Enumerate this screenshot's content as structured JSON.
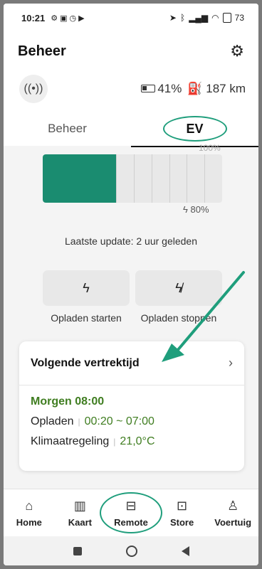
{
  "status_bar": {
    "time": "10:21",
    "battery": "73"
  },
  "app_bar": {
    "title": "Beheer"
  },
  "vehicle_info": {
    "battery_percent": "41%",
    "range": "187 km"
  },
  "tabs": [
    {
      "label": "Beheer"
    },
    {
      "label": "EV"
    }
  ],
  "battery": {
    "level_percent": 41,
    "max_label": "100%",
    "limit_label": "80%",
    "last_update": "Laatste update: 2 uur geleden"
  },
  "charge_actions": {
    "start_label": "Opladen starten",
    "stop_label": "Opladen stoppen"
  },
  "departure_card": {
    "title": "Volgende vertrektijd",
    "time": "Morgen 08:00",
    "charge_label": "Opladen",
    "charge_window": "00:20 ~ 07:00",
    "climate_label": "Klimaatregeling",
    "climate_temp": "21,0°C"
  },
  "bottom_nav": [
    {
      "label": "Home",
      "icon": "home-icon"
    },
    {
      "label": "Kaart",
      "icon": "map-icon"
    },
    {
      "label": "Remote",
      "icon": "car-icon"
    },
    {
      "label": "Store",
      "icon": "shopping-bag-icon"
    },
    {
      "label": "Voertuig",
      "icon": "vehicle-person-icon"
    }
  ],
  "colors": {
    "accent": "#1a8c70",
    "annotation": "#1f9e7c",
    "value_green": "#3f7d20"
  }
}
